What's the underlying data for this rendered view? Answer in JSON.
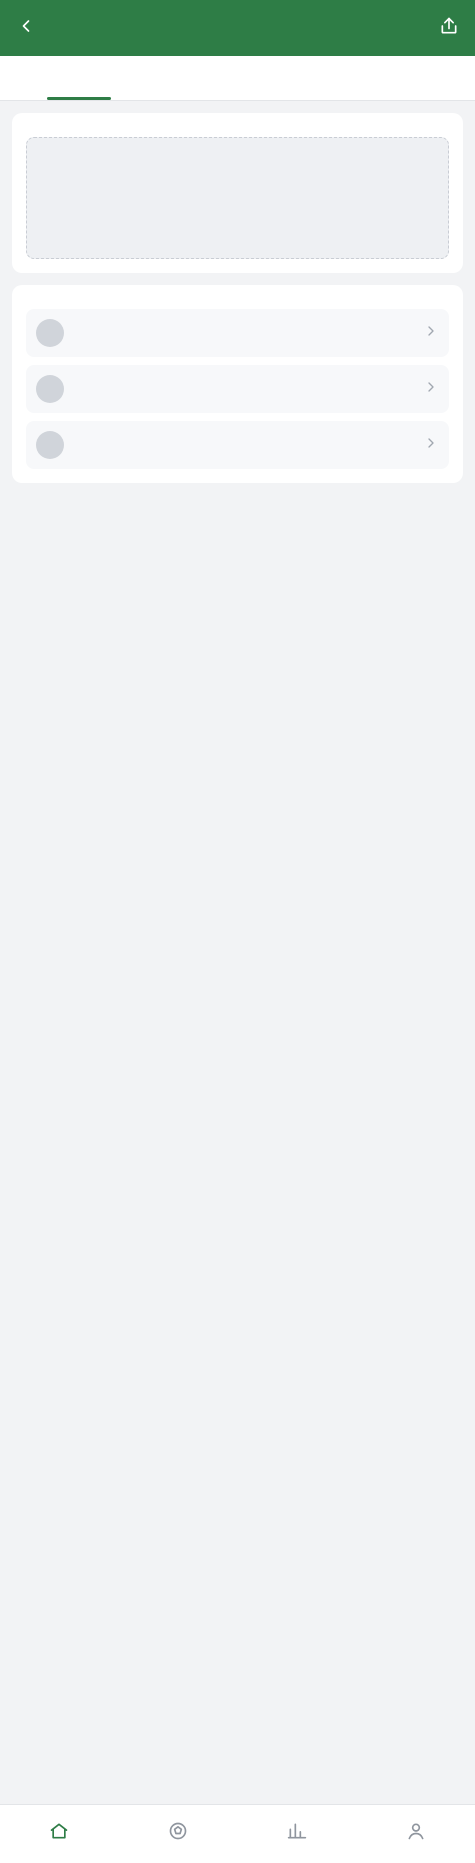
{
  "header": {
    "title": ""
  },
  "tabs": [
    {
      "label": ""
    },
    {
      "label": ""
    },
    {
      "label": ""
    }
  ],
  "sections": {
    "primary": {
      "title": "",
      "placeholder": ""
    },
    "secondary": {
      "title": "",
      "items": [
        {
          "primary": "",
          "secondary": ""
        },
        {
          "primary": "",
          "secondary": ""
        },
        {
          "primary": "",
          "secondary": ""
        }
      ]
    }
  },
  "bottom_nav": [
    {
      "label": ""
    },
    {
      "label": ""
    },
    {
      "label": ""
    },
    {
      "label": ""
    }
  ],
  "colors": {
    "accent": "#2e7d46"
  }
}
